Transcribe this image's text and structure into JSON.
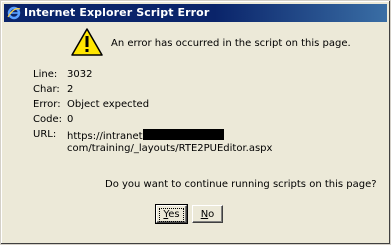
{
  "window": {
    "title": "Internet Explorer Script Error",
    "icon": "ie-icon"
  },
  "message": {
    "icon": "warning-icon",
    "text": "An error has occurred in the script on this page."
  },
  "details": {
    "line_label": "Line:",
    "line_value": "3032",
    "char_label": "Char:",
    "char_value": "2",
    "error_label": "Error:",
    "error_value": "Object expected",
    "code_label": "Code:",
    "code_value": "0",
    "url_label": "URL:",
    "url_prefix": "https://intranet",
    "url_suffix": "com/training/_layouts/RTE2PUEditor.aspx"
  },
  "question": "Do you want to continue running scripts on this page?",
  "buttons": {
    "yes_mnemonic": "Y",
    "yes_rest": "es",
    "no_mnemonic": "N",
    "no_rest": "o"
  },
  "colors": {
    "titlebar": "#0a246a",
    "dialog_bg": "#ece9d8",
    "warning_fill": "#ffe600"
  }
}
